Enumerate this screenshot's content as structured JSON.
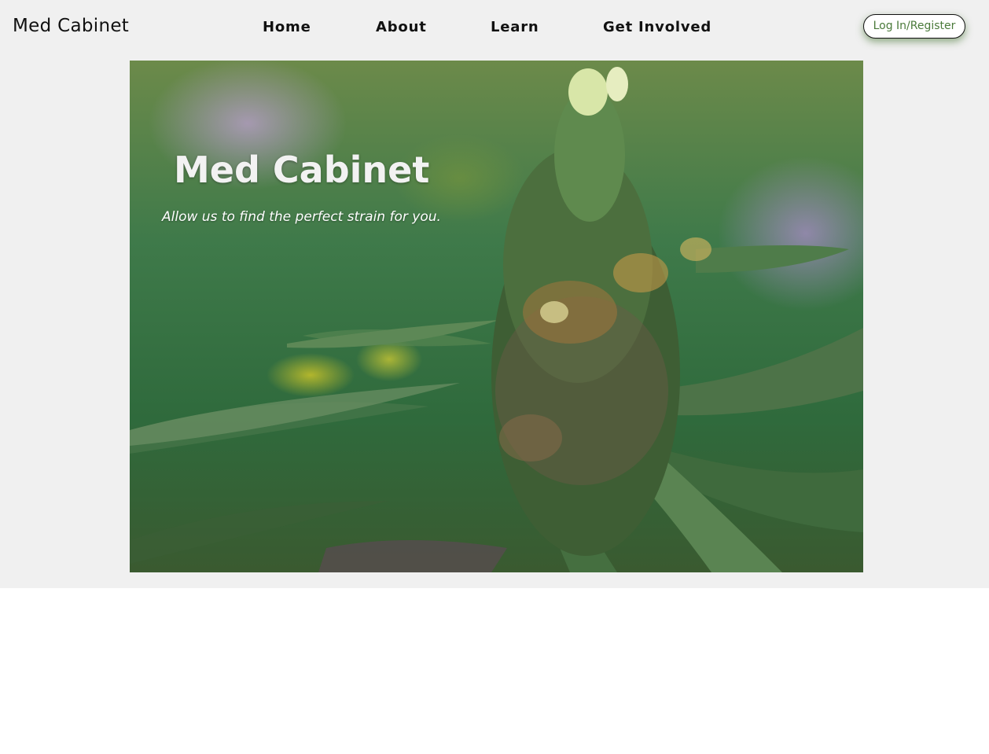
{
  "header": {
    "brand": "Med Cabinet",
    "nav": [
      "Home",
      "About",
      "Learn",
      "Get Involved"
    ],
    "login_label": "Log In/Register"
  },
  "hero": {
    "title": "Med Cabinet",
    "subtitle": "Allow us to find the perfect strain for you.",
    "image_subject": "cannabis-bud-photo"
  },
  "colors": {
    "band_background": "#f0f0f0",
    "login_text": "#4a7a3a",
    "login_glow": "#3c6e28"
  }
}
